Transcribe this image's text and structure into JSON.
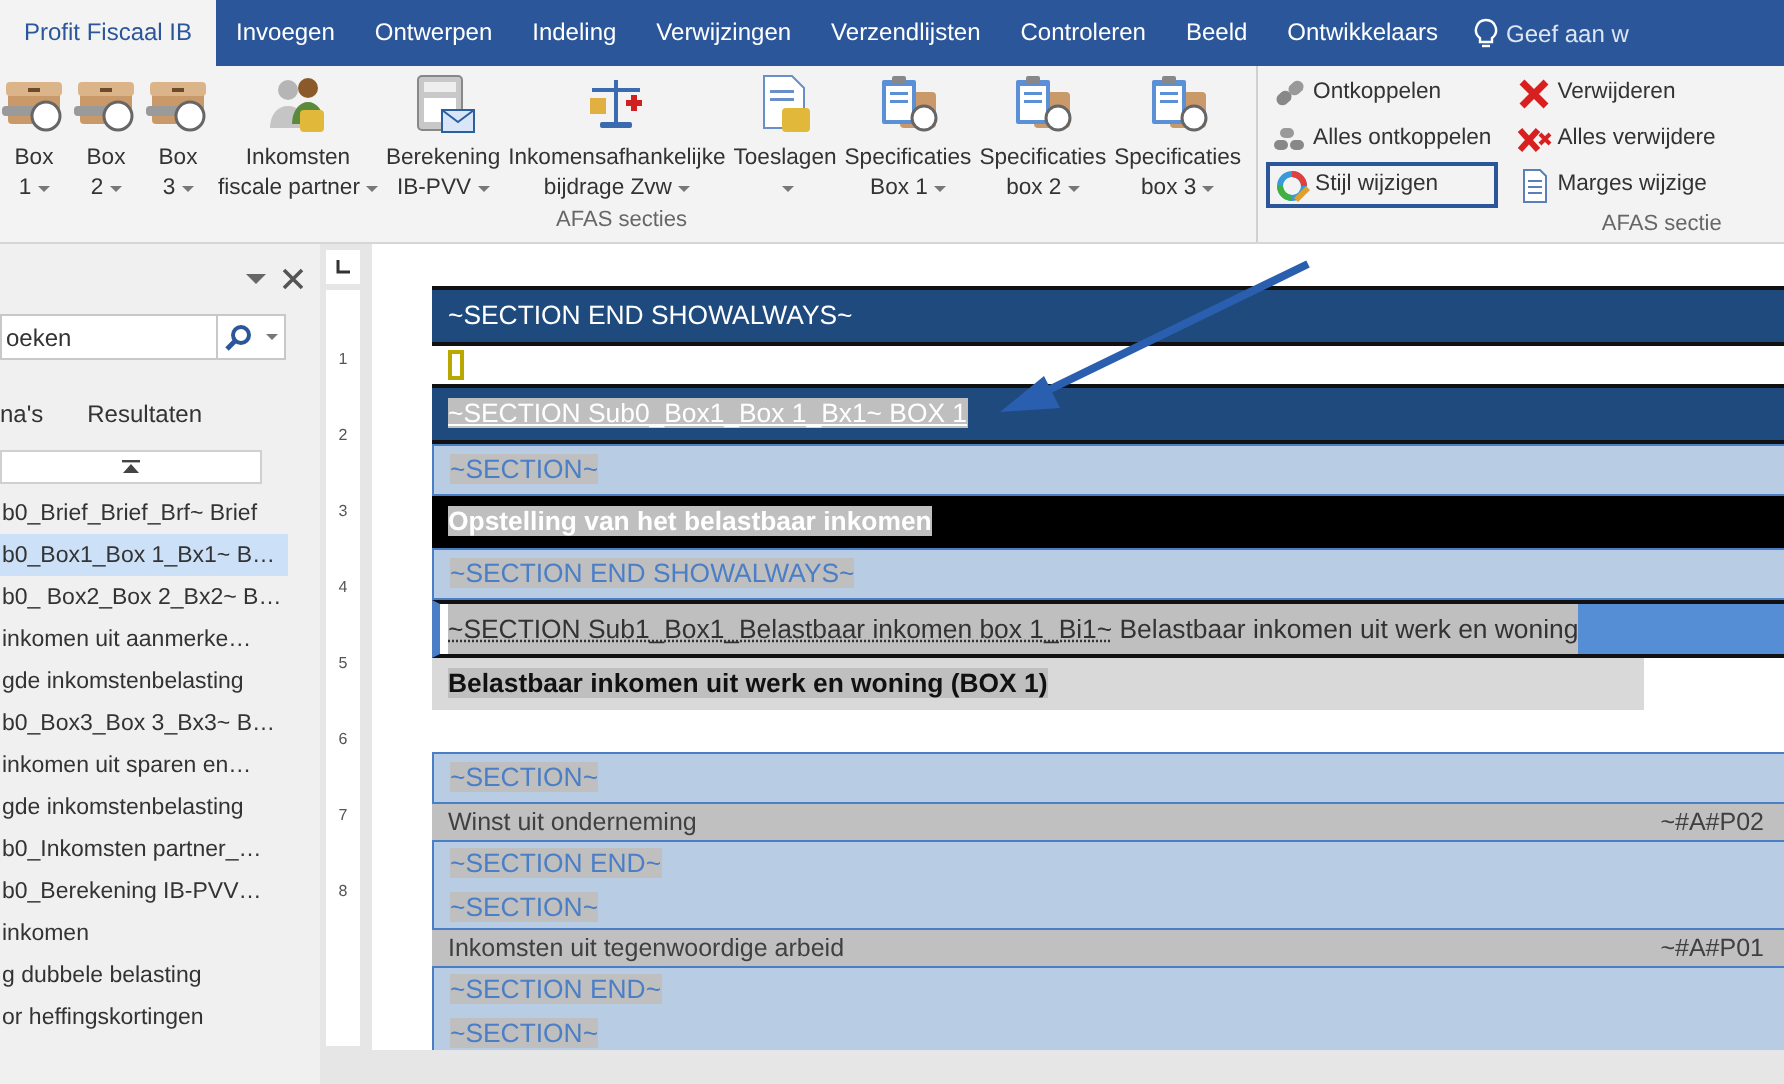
{
  "tabs": [
    {
      "label": "Profit Fiscaal IB",
      "selected": true
    },
    {
      "label": "Invoegen",
      "selected": false
    },
    {
      "label": "Ontwerpen",
      "selected": false
    },
    {
      "label": "Indeling",
      "selected": false
    },
    {
      "label": "Verwijzingen",
      "selected": false
    },
    {
      "label": "Verzendlijsten",
      "selected": false
    },
    {
      "label": "Controleren",
      "selected": false
    },
    {
      "label": "Beeld",
      "selected": false
    },
    {
      "label": "Ontwikkelaars",
      "selected": false
    }
  ],
  "tell_me": {
    "text": "Geef aan w"
  },
  "ribbon": {
    "groups": [
      {
        "label": "AFAS secties",
        "buttons": [
          {
            "lines": [
              "Box",
              "1"
            ]
          },
          {
            "lines": [
              "Box",
              "2"
            ]
          },
          {
            "lines": [
              "Box",
              "3"
            ]
          },
          {
            "lines": [
              "Inkomsten",
              "fiscale partner"
            ]
          },
          {
            "lines": [
              "Berekening",
              "IB-PVV"
            ]
          },
          {
            "lines": [
              "Inkomensafhankelijke",
              "bijdrage Zvw"
            ]
          },
          {
            "lines": [
              "Toeslagen"
            ]
          },
          {
            "lines": [
              "Specificaties",
              "Box 1"
            ]
          },
          {
            "lines": [
              "Specificaties",
              "box 2"
            ]
          },
          {
            "lines": [
              "Specificaties",
              "box 3"
            ]
          }
        ]
      },
      {
        "label": "AFAS sectie",
        "buttons": [
          {
            "label": "Ontkoppelen",
            "selected": false
          },
          {
            "label": "Alles ontkoppelen",
            "selected": false
          },
          {
            "label": "Stijl wijzigen",
            "selected": true
          },
          {
            "label": "Verwijderen",
            "selected": false
          },
          {
            "label": "Alles verwijdere",
            "selected": false
          },
          {
            "label": "Marges wijzige",
            "selected": false
          }
        ]
      }
    ]
  },
  "nav_pane": {
    "search": {
      "value": "oeken"
    },
    "tabs": [
      {
        "label": "na's",
        "selected": false
      },
      {
        "label": "Resultaten",
        "selected": false
      }
    ],
    "items": [
      {
        "label": "b0_Brief_Brief_Brf~ Brief",
        "selected": false
      },
      {
        "label": "b0_Box1_Box 1_Bx1~ B…",
        "selected": true
      },
      {
        "label": "b0_ Box2_Box 2_Bx2~ B…",
        "selected": false
      },
      {
        "label": "inkomen uit aanmerke…",
        "selected": false
      },
      {
        "label": "gde inkomstenbelasting",
        "selected": false
      },
      {
        "label": "b0_Box3_Box 3_Bx3~ B…",
        "selected": false
      },
      {
        "label": "inkomen uit sparen en…",
        "selected": false
      },
      {
        "label": "gde inkomstenbelasting",
        "selected": false
      },
      {
        "label": "b0_Inkomsten partner_…",
        "selected": false
      },
      {
        "label": "b0_Berekening IB-PVV…",
        "selected": false
      },
      {
        "label": "inkomen",
        "selected": false
      },
      {
        "label": "g dubbele belasting",
        "selected": false
      },
      {
        "label": "or heffingskortingen",
        "selected": false
      }
    ]
  },
  "ruler": {
    "numbers": [
      "1",
      "2",
      "3",
      "4",
      "5",
      "6",
      "7",
      "8"
    ]
  },
  "document": {
    "blocks": [
      {
        "kind": "dark",
        "lines": [
          "~SECTION END SHOWALWAYS~"
        ],
        "highlighted": false,
        "underlined": false
      },
      {
        "kind": "cursor"
      },
      {
        "kind": "dark",
        "lines": [
          "~SECTION Sub0_Box1_Box 1_Bx1~ BOX 1"
        ],
        "highlighted": true,
        "underlined": true
      },
      {
        "kind": "light",
        "lines": [
          "~SECTION~"
        ]
      },
      {
        "kind": "black",
        "lines": [
          "Opstelling van het belastbaar inkomen"
        ]
      },
      {
        "kind": "light",
        "lines": [
          "~SECTION END SHOWALWAYS~"
        ]
      },
      {
        "kind": "mixed",
        "field": "~SECTION Sub1_Box1_Belastbaar inkomen box 1_Bi1~",
        "text": " Belastbaar inkomen uit werk en woning"
      },
      {
        "kind": "heading",
        "lines": [
          "Belastbaar inkomen uit werk en woning (BOX 1)"
        ]
      },
      {
        "kind": "gap"
      },
      {
        "kind": "light",
        "lines": [
          "~SECTION~"
        ]
      },
      {
        "kind": "row",
        "label": "Winst uit onderneming",
        "code": "~#A#P02"
      },
      {
        "kind": "light",
        "lines": [
          "~SECTION END~",
          "~SECTION~"
        ]
      },
      {
        "kind": "row",
        "label": "Inkomsten uit tegenwoordige arbeid",
        "code": "~#A#P01"
      },
      {
        "kind": "light",
        "lines": [
          "~SECTION END~",
          "~SECTION~"
        ]
      }
    ]
  }
}
